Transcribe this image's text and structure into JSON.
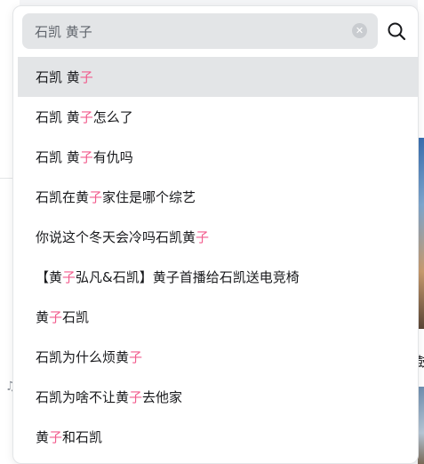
{
  "search": {
    "value": "石凯 黄子",
    "placeholder": "石凯 黄子"
  },
  "icons": {
    "clear": "clear-icon",
    "search": "search-icon"
  },
  "colors": {
    "highlight": "#f25d8e",
    "active_row": "#e3e5e7",
    "text": "#18191c"
  },
  "background": {
    "right_text": "鼓",
    "emoji": "♫"
  },
  "suggestions": [
    [
      {
        "t": "石凯 黄"
      },
      {
        "t": "子",
        "hl": true
      }
    ],
    [
      {
        "t": "石凯 黄"
      },
      {
        "t": "子",
        "hl": true
      },
      {
        "t": "怎么了"
      }
    ],
    [
      {
        "t": "石凯 黄"
      },
      {
        "t": "子",
        "hl": true
      },
      {
        "t": " 有仇吗"
      }
    ],
    [
      {
        "t": "石凯在黄"
      },
      {
        "t": "子",
        "hl": true
      },
      {
        "t": "家住是哪个综艺"
      }
    ],
    [
      {
        "t": "你说这个冬天会冷吗石凯黄"
      },
      {
        "t": "子",
        "hl": true
      }
    ],
    [
      {
        "t": "【黄"
      },
      {
        "t": "子",
        "hl": true
      },
      {
        "t": "弘凡&石凯】黄子首播给石凯送电竞椅"
      }
    ],
    [
      {
        "t": "黄"
      },
      {
        "t": "子",
        "hl": true
      },
      {
        "t": " 石凯"
      }
    ],
    [
      {
        "t": "石凯为什么烦黄"
      },
      {
        "t": "子",
        "hl": true
      }
    ],
    [
      {
        "t": "石凯为啥不让黄"
      },
      {
        "t": "子",
        "hl": true
      },
      {
        "t": "去他家"
      }
    ],
    [
      {
        "t": "黄"
      },
      {
        "t": "子",
        "hl": true
      },
      {
        "t": "和石凯"
      }
    ]
  ]
}
